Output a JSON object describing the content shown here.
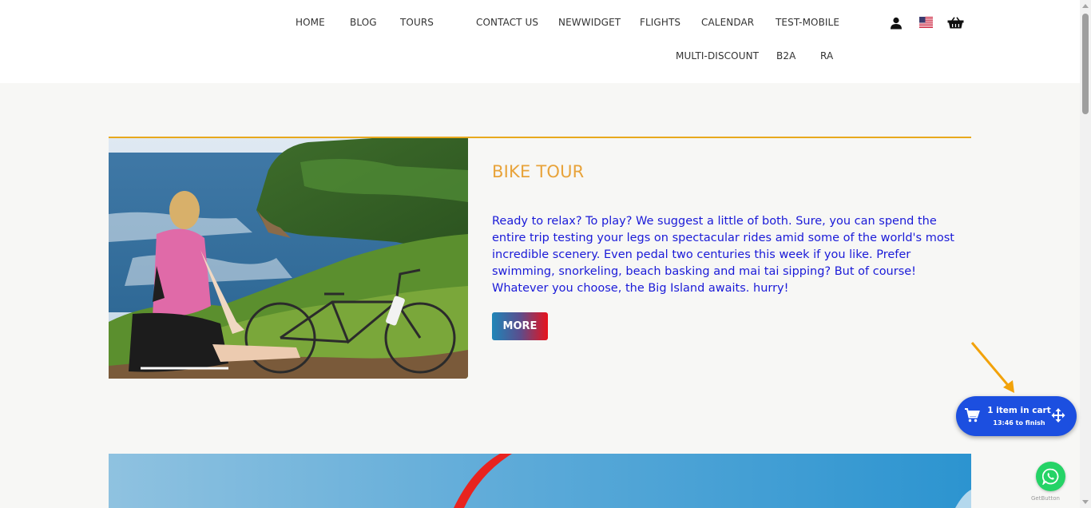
{
  "nav": {
    "row1": [
      "HOME",
      "BLOG",
      "TOURS",
      "CONTACT US",
      "NEWWIDGET",
      "FLIGHTS",
      "CALENDAR",
      "TEST-MOBILE"
    ],
    "row2": [
      "MULTI-DISCOUNT",
      "B2A",
      "RA"
    ]
  },
  "header_icons": [
    "user-icon",
    "us-flag-icon",
    "basket-icon"
  ],
  "tour": {
    "title": "BIKE TOUR",
    "description": "Ready to relax? To play? We suggest a little of both. Sure, you can spend the entire trip testing your legs on spectacular rides amid some of the world's most incredible scenery. Even pedal two centuries this week if you like. Prefer swimming, snorkeling, beach basking and mai tai sipping? But of course! Whatever you choose, the Big Island awaits. hurry!",
    "more_label": "MORE"
  },
  "cart": {
    "title": "1 item in cart",
    "timer": "13:46 to finish"
  },
  "whatsapp": {
    "brand": "GetButton"
  },
  "colors": {
    "accent_orange": "#e8a91d",
    "title_orange": "#e8a33a",
    "desc_blue": "#1a1ad8",
    "cart_blue": "#1c4fe0",
    "whatsapp_green": "#25d366"
  }
}
